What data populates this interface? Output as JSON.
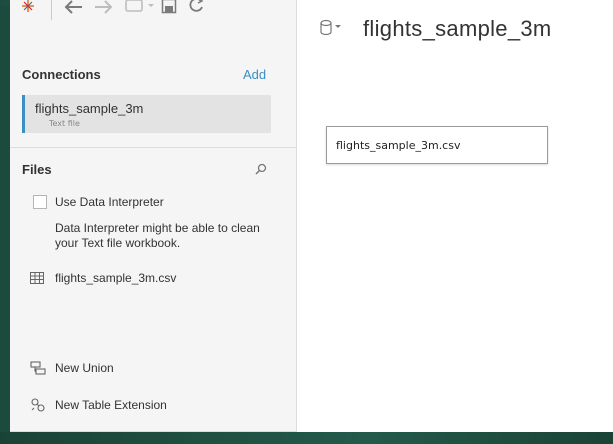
{
  "connections": {
    "title": "Connections",
    "add_label": "Add",
    "items": [
      {
        "name": "flights_sample_3m",
        "type": "Text file"
      }
    ]
  },
  "files": {
    "title": "Files",
    "search_icon": "search-icon",
    "use_interpreter_label": "Use Data Interpreter",
    "use_interpreter_checked": false,
    "interpreter_description": "Data Interpreter might be able to clean your Text file workbook.",
    "items": [
      {
        "name": "flights_sample_3m.csv",
        "icon": "table-grid-icon"
      }
    ],
    "actions": [
      {
        "label": "New Union",
        "icon": "union-icon"
      },
      {
        "label": "New Table Extension",
        "icon": "table-extension-icon"
      }
    ]
  },
  "datasource": {
    "name": "flights_sample_3m",
    "icon": "database-icon",
    "canvas_table": "flights_sample_3m.csv"
  },
  "toolbar": {
    "icons": [
      "tableau-logo-icon",
      "back-arrow-icon",
      "forward-arrow-icon",
      "datasource-dropdown-icon",
      "save-icon",
      "refresh-icon"
    ]
  },
  "colors": {
    "accent": "#3a8fc4",
    "frame": "#1c4a3c",
    "pane_bg": "#f5f5f5",
    "selected_item_bg": "#e3e3e3"
  }
}
